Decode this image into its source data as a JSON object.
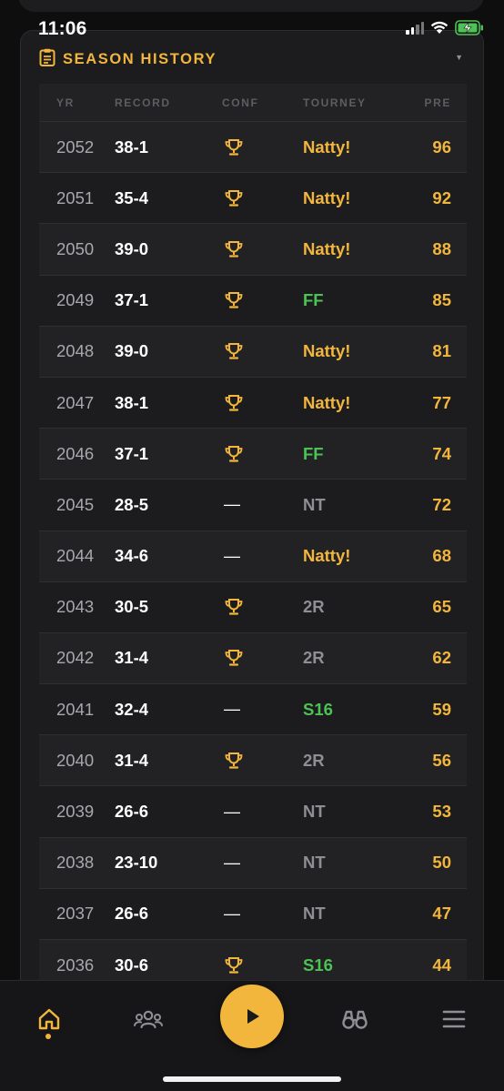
{
  "status_bar": {
    "time": "11:06"
  },
  "panel": {
    "title": "SEASON HISTORY"
  },
  "table": {
    "columns": [
      "YR",
      "RECORD",
      "CONF",
      "TOURNEY",
      "PRE"
    ],
    "rows": [
      {
        "yr": "2052",
        "record": "38-1",
        "conf": "trophy",
        "tourney": "Natty!",
        "tourney_color": "#f2b63d",
        "pre": "96"
      },
      {
        "yr": "2051",
        "record": "35-4",
        "conf": "trophy",
        "tourney": "Natty!",
        "tourney_color": "#f2b63d",
        "pre": "92"
      },
      {
        "yr": "2050",
        "record": "39-0",
        "conf": "trophy",
        "tourney": "Natty!",
        "tourney_color": "#f2b63d",
        "pre": "88"
      },
      {
        "yr": "2049",
        "record": "37-1",
        "conf": "trophy",
        "tourney": "FF",
        "tourney_color": "#4cc354",
        "pre": "85"
      },
      {
        "yr": "2048",
        "record": "39-0",
        "conf": "trophy",
        "tourney": "Natty!",
        "tourney_color": "#f2b63d",
        "pre": "81"
      },
      {
        "yr": "2047",
        "record": "38-1",
        "conf": "trophy",
        "tourney": "Natty!",
        "tourney_color": "#f2b63d",
        "pre": "77"
      },
      {
        "yr": "2046",
        "record": "37-1",
        "conf": "trophy",
        "tourney": "FF",
        "tourney_color": "#4cc354",
        "pre": "74"
      },
      {
        "yr": "2045",
        "record": "28-5",
        "conf": "—",
        "tourney": "NT",
        "tourney_color": "#8e8e93",
        "pre": "72"
      },
      {
        "yr": "2044",
        "record": "34-6",
        "conf": "—",
        "tourney": "Natty!",
        "tourney_color": "#f2b63d",
        "pre": "68"
      },
      {
        "yr": "2043",
        "record": "30-5",
        "conf": "trophy",
        "tourney": "2R",
        "tourney_color": "#8e8e93",
        "pre": "65"
      },
      {
        "yr": "2042",
        "record": "31-4",
        "conf": "trophy",
        "tourney": "2R",
        "tourney_color": "#8e8e93",
        "pre": "62"
      },
      {
        "yr": "2041",
        "record": "32-4",
        "conf": "—",
        "tourney": "S16",
        "tourney_color": "#4cc354",
        "pre": "59"
      },
      {
        "yr": "2040",
        "record": "31-4",
        "conf": "trophy",
        "tourney": "2R",
        "tourney_color": "#8e8e93",
        "pre": "56"
      },
      {
        "yr": "2039",
        "record": "26-6",
        "conf": "—",
        "tourney": "NT",
        "tourney_color": "#8e8e93",
        "pre": "53"
      },
      {
        "yr": "2038",
        "record": "23-10",
        "conf": "—",
        "tourney": "NT",
        "tourney_color": "#8e8e93",
        "pre": "50"
      },
      {
        "yr": "2037",
        "record": "26-6",
        "conf": "—",
        "tourney": "NT",
        "tourney_color": "#8e8e93",
        "pre": "47"
      },
      {
        "yr": "2036",
        "record": "30-6",
        "conf": "trophy",
        "tourney": "S16",
        "tourney_color": "#4cc354",
        "pre": "44"
      }
    ]
  },
  "tabbar": {
    "tabs": [
      "home-icon",
      "group-icon",
      "play-icon",
      "binoculars-icon",
      "menu-icon"
    ],
    "active": "home-icon"
  },
  "colors": {
    "accent": "#f2b63d",
    "green": "#4cc354",
    "muted": "#8e8e93"
  }
}
